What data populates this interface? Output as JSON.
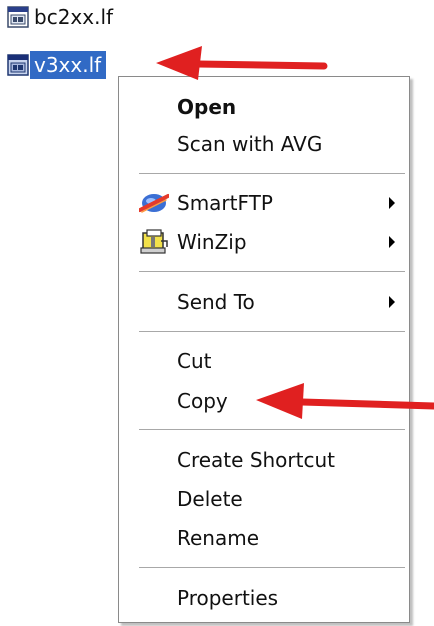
{
  "files": [
    {
      "name": "bc2xx.lf",
      "icon": "lf-file-icon",
      "selected": false
    },
    {
      "name": "v3xx.lf",
      "icon": "lf-file-icon",
      "selected": true
    }
  ],
  "context_menu": {
    "items": [
      {
        "label": "Open",
        "bold": true
      },
      {
        "label": "Scan with AVG"
      },
      {
        "label": "SmartFTP",
        "icon": "smartftp-icon",
        "submenu": true
      },
      {
        "label": "WinZip",
        "icon": "winzip-icon",
        "submenu": true
      },
      {
        "label": "Send To",
        "submenu": true
      },
      {
        "label": "Cut"
      },
      {
        "label": "Copy"
      },
      {
        "label": "Create Shortcut"
      },
      {
        "label": "Delete"
      },
      {
        "label": "Rename"
      },
      {
        "label": "Properties"
      }
    ]
  },
  "colors": {
    "selection": "#316ac5",
    "annotation_arrow": "#e02020"
  }
}
